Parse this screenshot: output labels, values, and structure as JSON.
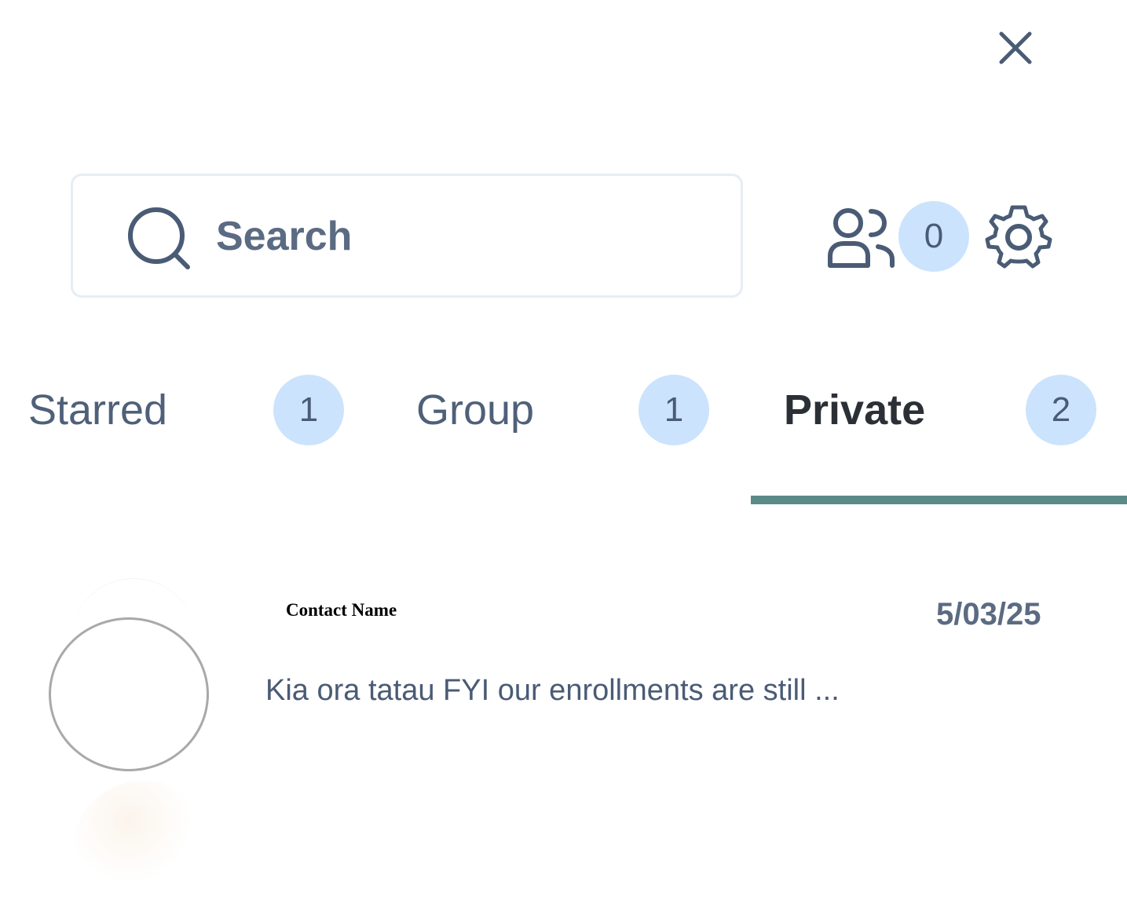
{
  "header": {
    "close_icon": "close-icon"
  },
  "search": {
    "placeholder": "Search"
  },
  "toolbar": {
    "contacts_icon": "users-icon",
    "contacts_count": "0",
    "settings_icon": "gear-icon"
  },
  "tabs": [
    {
      "label": "Starred",
      "count": "1",
      "active": false
    },
    {
      "label": "Group",
      "count": "1",
      "active": false
    },
    {
      "label": "Private",
      "count": "2",
      "active": true
    }
  ],
  "conversations": [
    {
      "name": "Contact Name",
      "date": "5/03/25",
      "preview": "Kia ora tatau FYI our enrollments are still ..."
    }
  ],
  "colors": {
    "badge_bg": "#cbe3fd",
    "active_underline": "#5b8a88",
    "text": "#4a5b75"
  }
}
